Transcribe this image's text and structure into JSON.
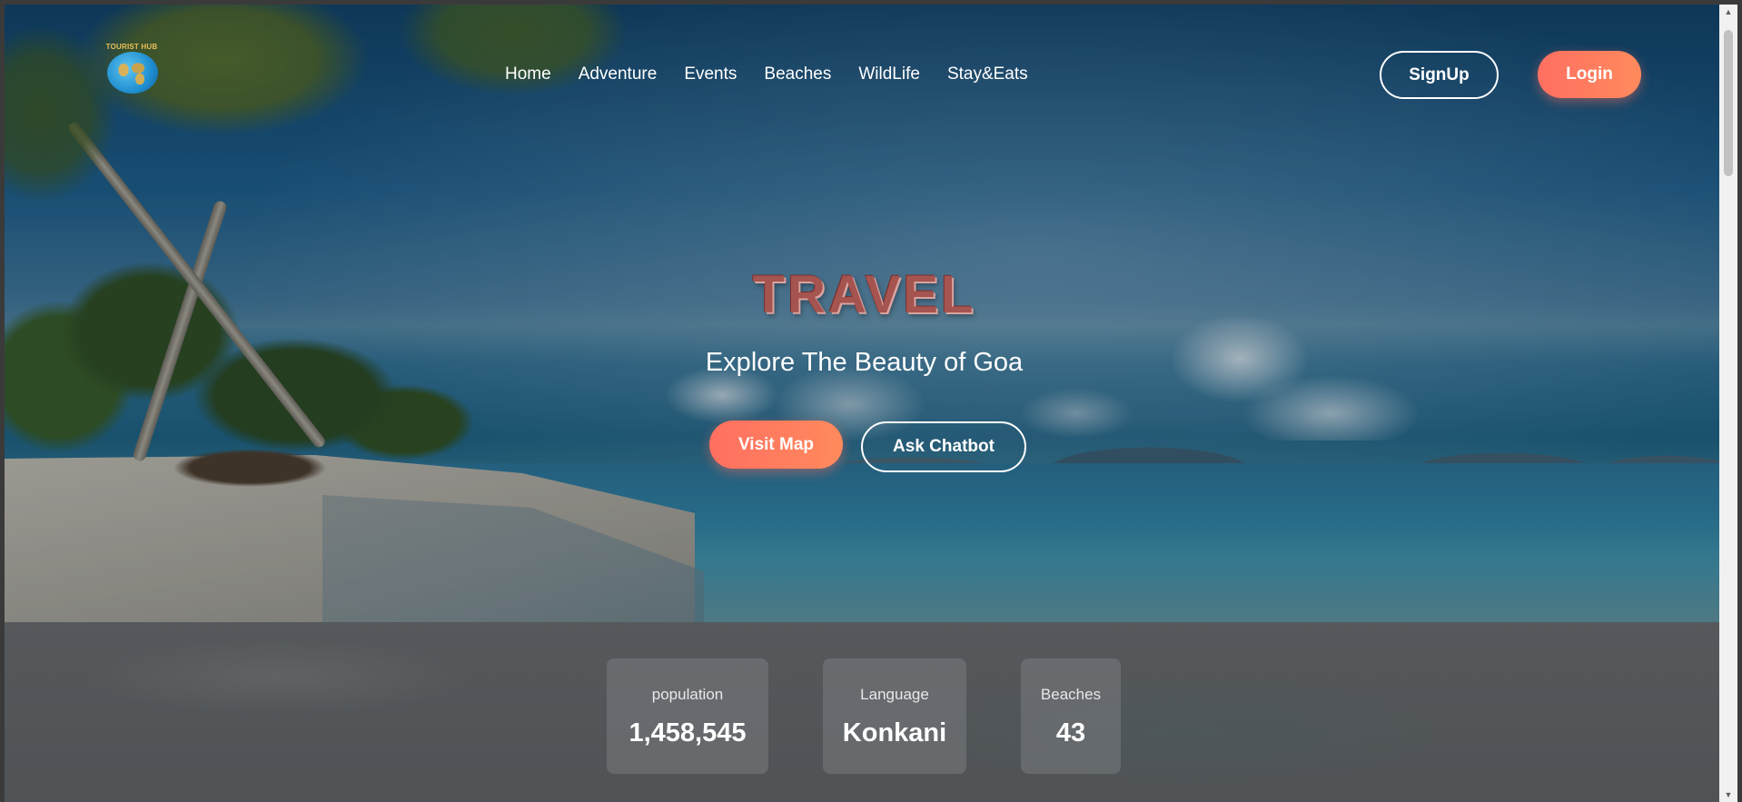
{
  "brand": {
    "logo_text": "TOURIST HUB"
  },
  "nav": {
    "links": [
      "Home",
      "Adventure",
      "Events",
      "Beaches",
      "WildLife",
      "Stay&Eats"
    ]
  },
  "auth": {
    "signup_label": "SignUp",
    "login_label": "Login"
  },
  "hero": {
    "title": "TRAVEL",
    "subtitle": "Explore The Beauty of Goa",
    "primary_button": "Visit Map",
    "secondary_button": "Ask Chatbot"
  },
  "stats": [
    {
      "label": "population",
      "value": "1,458,545"
    },
    {
      "label": "Language",
      "value": "Konkani"
    },
    {
      "label": "Beaches",
      "value": "43"
    }
  ],
  "theme": {
    "accent": "#ff6f61",
    "accent_end": "#ff8a5c",
    "title_color": "#a55450"
  },
  "icons": {
    "scroll_up": "▲",
    "scroll_down": "▼"
  }
}
